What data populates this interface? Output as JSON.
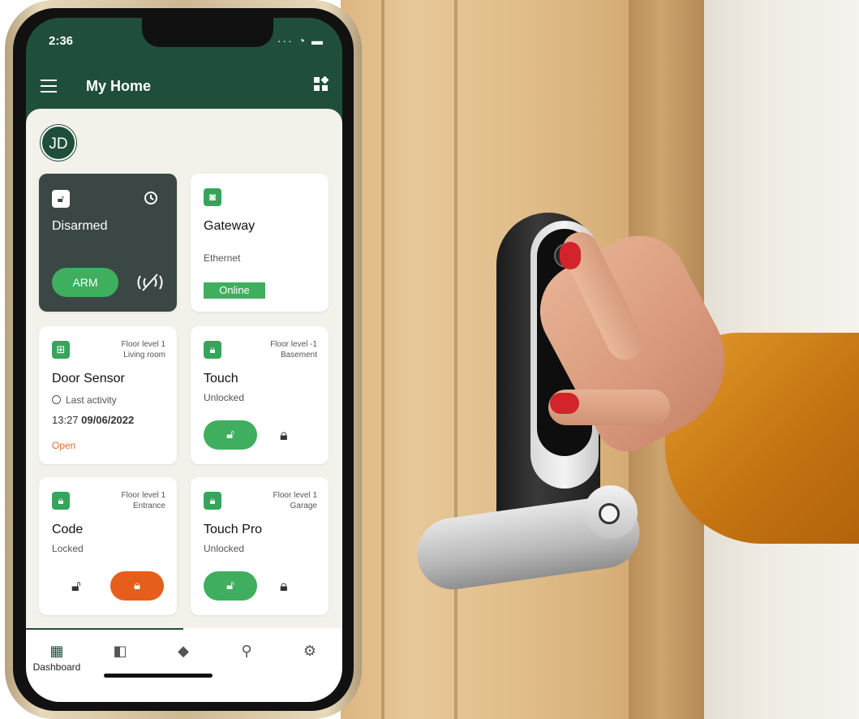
{
  "status_bar": {
    "time": "2:36",
    "indicators": "···"
  },
  "app_bar": {
    "title": "My Home",
    "menu_icon": "hamburger-menu-icon",
    "right_icon": "widgets-icon"
  },
  "user": {
    "initials": "JD"
  },
  "cards": {
    "alarm": {
      "status": "Disarmed",
      "arm_label": "ARM",
      "icons": [
        "unlocked-padlock-icon",
        "history-icon",
        "alarm-off-icon"
      ]
    },
    "gateway": {
      "title": "Gateway",
      "connection": "Ethernet",
      "state": "Online"
    },
    "door_sensor": {
      "floor": "Floor level 1",
      "room": "Living room",
      "title": "Door Sensor",
      "activity_label": "Last activity",
      "time": "13:27",
      "date": "09/06/2022",
      "state": "Open"
    },
    "touch": {
      "floor": "Floor level -1",
      "room": "Basement",
      "title": "Touch",
      "state": "Unlocked"
    },
    "code": {
      "floor": "Floor level 1",
      "room": "Entrance",
      "title": "Code",
      "state": "Locked"
    },
    "touch_pro": {
      "floor": "Floor level 1",
      "room": "Garage",
      "title": "Touch Pro",
      "state": "Unlocked"
    }
  },
  "tabs": [
    {
      "label": "Dashboard",
      "icon": "dashboard-icon"
    },
    {
      "label": "",
      "icon": "rooms-icon"
    },
    {
      "label": "",
      "icon": "automation-icon"
    },
    {
      "label": "",
      "icon": "location-icon"
    },
    {
      "label": "",
      "icon": "settings-icon"
    }
  ],
  "colors": {
    "brand": "#1f4f3a",
    "accent_green": "#3fae5e",
    "alert_orange": "#e55e1b",
    "open_text": "#e26c2c"
  }
}
